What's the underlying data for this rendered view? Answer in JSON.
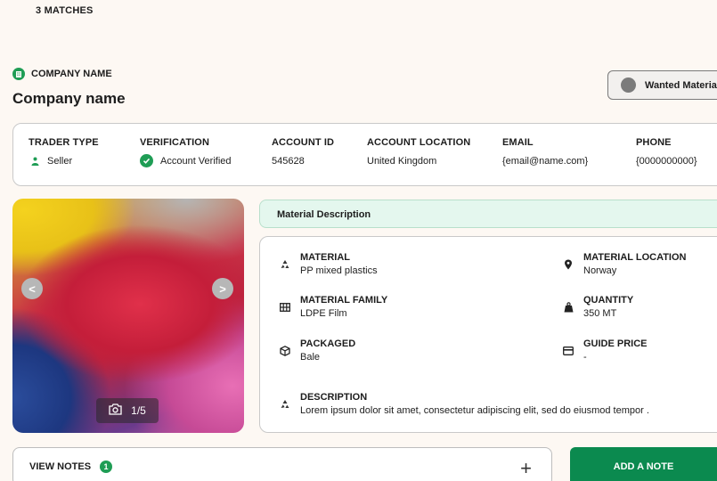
{
  "matches": "3 MATCHES",
  "company": {
    "label": "COMPANY NAME",
    "title": "Company name",
    "wanted_button": "Wanted Materia"
  },
  "trader": {
    "columns": [
      {
        "header": "TRADER TYPE",
        "value": "Seller"
      },
      {
        "header": "VERIFICATION",
        "value": "Account Verified"
      },
      {
        "header": "ACCOUNT ID",
        "value": "545628"
      },
      {
        "header": "ACCOUNT LOCATION",
        "value": "United Kingdom"
      },
      {
        "header": "EMAIL",
        "value": "{email@name.com}"
      },
      {
        "header": "PHONE",
        "value": "{0000000000}"
      }
    ]
  },
  "photo": {
    "prev": "<",
    "next": ">",
    "counter": "1/5"
  },
  "material": {
    "section_title": "Material Description",
    "material_label": "MATERIAL",
    "material_value": "PP mixed plastics",
    "location_label": "MATERIAL LOCATION",
    "location_value": "Norway",
    "family_label": "MATERIAL FAMILY",
    "family_value": "LDPE Film",
    "quantity_label": "QUANTITY",
    "quantity_value": "350 MT",
    "packaged_label": "PACKAGED",
    "packaged_value": "Bale",
    "price_label": "GUIDE PRICE",
    "price_value": "-",
    "description_label": "DESCRIPTION",
    "description_value": "Lorem ipsum dolor sit amet, consectetur adipiscing elit, sed do eiusmod tempor ."
  },
  "notes": {
    "label": "VIEW NOTES",
    "count": "1",
    "add_button": "ADD A NOTE"
  },
  "colors": {
    "brand_green": "#0b8a4f",
    "accent_green": "#1f9d55",
    "background": "#fdf8f3"
  }
}
